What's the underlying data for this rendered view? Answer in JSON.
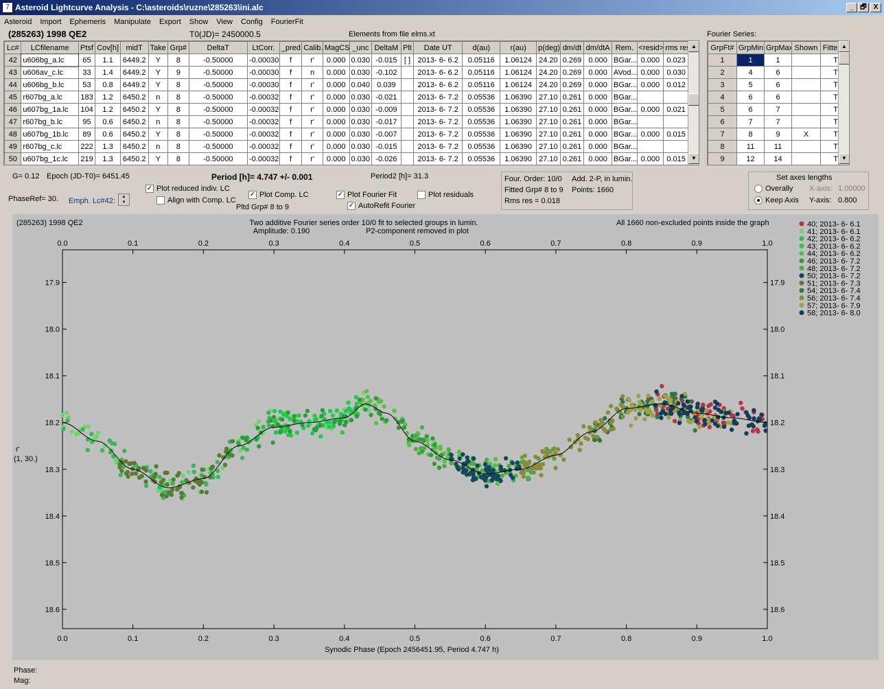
{
  "window": {
    "title": "Asteroid Lightcurve Analysis - C:\\asteroids\\ruzne\\285263\\ini.alc",
    "min": "_",
    "max": "🗗",
    "close": "X"
  },
  "menu": [
    "Asteroid",
    "Import",
    "Ephemeris",
    "Manipulate",
    "Export",
    "Show",
    "View",
    "Config",
    "FourierFit"
  ],
  "header": {
    "asteroid": "(285263) 1998 QE2",
    "t0": "T0(JD)= 2450000.5",
    "elements": "Elements from file elms.xt",
    "fourier_label": "Fourier Series:"
  },
  "lc_table": {
    "columns": [
      "Lc#",
      "LCfilename",
      "Ptsf",
      "Cov[h]",
      "midT",
      "Take",
      "Grp#",
      "DeltaT",
      "LtCorr.",
      "_pred.",
      "Calib.",
      "MagCS",
      "_unc",
      "DeltaM",
      "Plt",
      "Date UT",
      "d(au)",
      "r(au)",
      "p(deg)",
      "dm/dt",
      "dm/dtA",
      "Rem.",
      "<resid>",
      "rms res"
    ],
    "rows": [
      [
        "42",
        "u606bg_a.lc",
        "65",
        "1.1",
        "6449.2",
        "Y",
        "8",
        "-0.50000",
        "-0.00030",
        "f",
        "r'",
        "0.000",
        "0.030",
        "-0.015",
        "[ ]",
        "2013- 6- 6.2",
        "0.05116",
        "1.06124",
        "24.20",
        "0.269",
        "0.000",
        "BGar...",
        "0.000",
        "0.023"
      ],
      [
        "43",
        "u606av_c.lc",
        "33",
        "1.4",
        "6449.2",
        "Y",
        "9",
        "-0.50000",
        "-0.00030",
        "f",
        "n",
        "0.000",
        "0.030",
        "-0.102",
        "",
        "2013- 6- 6.2",
        "0.05116",
        "1.06124",
        "24.20",
        "0.269",
        "0.000",
        "AVod...",
        "0.000",
        "0.030"
      ],
      [
        "44",
        "u606bg_b.lc",
        "53",
        "0.8",
        "6449.2",
        "Y",
        "8",
        "-0.50000",
        "-0.00030",
        "f",
        "r'",
        "0.000",
        "0.040",
        "0.039",
        "",
        "2013- 6- 6.2",
        "0.05116",
        "1.06124",
        "24.20",
        "0.269",
        "0.000",
        "BGar...",
        "0.000",
        "0.012"
      ],
      [
        "45",
        "r607bg_a.lc",
        "183",
        "1.2",
        "6450.2",
        "n",
        "8",
        "-0.50000",
        "-0.00032",
        "f",
        "r'",
        "0.000",
        "0.030",
        "-0.021",
        "",
        "2013- 6- 7.2",
        "0.05536",
        "1.06390",
        "27.10",
        "0.261",
        "0.000",
        "BGar...",
        "",
        ""
      ],
      [
        "46",
        "u607bg_1a.lc",
        "104",
        "1.2",
        "6450.2",
        "Y",
        "8",
        "-0.50000",
        "-0.00032",
        "f",
        "r'",
        "0.000",
        "0.030",
        "-0.009",
        "",
        "2013- 6- 7.2",
        "0.05536",
        "1.06390",
        "27.10",
        "0.261",
        "0.000",
        "BGar...",
        "0.000",
        "0.021"
      ],
      [
        "47",
        "r607bg_b.lc",
        "95",
        "0.6",
        "6450.2",
        "n",
        "8",
        "-0.50000",
        "-0.00032",
        "f",
        "r'",
        "0.000",
        "0.030",
        "-0.017",
        "",
        "2013- 6- 7.2",
        "0.05536",
        "1.06390",
        "27.10",
        "0.261",
        "0.000",
        "BGar...",
        "",
        ""
      ],
      [
        "48",
        "u607bg_1b.lc",
        "89",
        "0.6",
        "6450.2",
        "Y",
        "8",
        "-0.50000",
        "-0.00032",
        "f",
        "r'",
        "0.000",
        "0.030",
        "-0.007",
        "",
        "2013- 6- 7.2",
        "0.05536",
        "1.06390",
        "27.10",
        "0.261",
        "0.000",
        "BGar...",
        "0.000",
        "0.015"
      ],
      [
        "49",
        "r607bg_c.lc",
        "222",
        "1.3",
        "6450.2",
        "n",
        "8",
        "-0.50000",
        "-0.00032",
        "f",
        "r'",
        "0.000",
        "0.030",
        "-0.015",
        "",
        "2013- 6- 7.2",
        "0.05536",
        "1.06390",
        "27.10",
        "0.261",
        "0.000",
        "BGar...",
        "",
        ""
      ],
      [
        "50",
        "u607bg_1c.lc",
        "219",
        "1.3",
        "6450.2",
        "Y",
        "8",
        "-0.50000",
        "-0.00032",
        "f",
        "r'",
        "0.000",
        "0.030",
        "-0.026",
        "",
        "2013- 6- 7.2",
        "0.05536",
        "1.06390",
        "27.10",
        "0.261",
        "0.000",
        "BGar...",
        "0.000",
        "0.015"
      ]
    ]
  },
  "fourier_table": {
    "columns": [
      "GrpFt#",
      "GrpMin",
      "GrpMax",
      "Shown",
      "Fitte"
    ],
    "rows": [
      [
        "1",
        "1",
        "1",
        "",
        "T"
      ],
      [
        "2",
        "4",
        "6",
        "",
        "T"
      ],
      [
        "3",
        "5",
        "6",
        "",
        "T"
      ],
      [
        "4",
        "6",
        "6",
        "",
        "T"
      ],
      [
        "5",
        "6",
        "7",
        "",
        "T"
      ],
      [
        "6",
        "7",
        "7",
        "",
        "T"
      ],
      [
        "7",
        "8",
        "9",
        "X",
        "T"
      ],
      [
        "8",
        "11",
        "11",
        "",
        "T"
      ],
      [
        "9",
        "12",
        "14",
        "",
        "T"
      ]
    ]
  },
  "params": {
    "g": "G= 0.12",
    "epoch": "Epoch (JD-T0)= 6451.45",
    "period": "Period [h]= 4.747 +/- 0.001",
    "period2": "Period2 [h]= 31.3",
    "phaseref": "PhaseRef= 30.",
    "emph": "Emph. Lc#42:"
  },
  "options": {
    "plot_reduced": "Plot reduced indiv. LC",
    "align": "Align with Comp. LC",
    "plot_comp": "Plot Comp. LC",
    "pltd_grp": "Pltd Grp#  8  to  9",
    "plot_fourier": "Plot Fourier Fit",
    "autorefit": "AutoRefit Fourier",
    "plot_resid": "Plot residuals"
  },
  "fit_info": {
    "order": "Four. Order: 10/0",
    "add": "Add. 2-P, in lumin.",
    "fitted": "Fitted Grp# 8 to 9",
    "points": "Points: 1660",
    "rms": "Rms res     = 0.018"
  },
  "axes_box": {
    "title": "Set axes lengths",
    "overall": "Overally",
    "keep": "Keep Axis",
    "xaxis": "X-axis:",
    "xval": "1.00000",
    "yaxis": "Y-axis:",
    "yval": "0.800"
  },
  "footer": {
    "phase": "Phase:",
    "mag": "Mag:"
  },
  "chart_data": {
    "type": "scatter",
    "title": "Two additive Fourier series order 10/0 fit to selected groups in lumin.",
    "subtitle": "Amplitude: 0.190",
    "note": "P2-component removed in plot",
    "corner_label": "(285263) 1998 QE2",
    "points_note": "All 1660 non-excluded points inside the graph",
    "xlabel": "Synodic Phase (Epoch 2456451.95, Period 4.747 h)",
    "ylabel": "r'",
    "ylabel2": "(1, 30.)",
    "xlim": [
      0,
      1
    ],
    "ylim": [
      18.8,
      17.8
    ],
    "y_inverted": true,
    "x_ticks": [
      "0.0",
      "0.1",
      "0.2",
      "0.3",
      "0.4",
      "0.5",
      "0.6",
      "0.7",
      "0.8",
      "0.9",
      "1.0"
    ],
    "y_ticks": [
      "17.9",
      "18.0",
      "18.1",
      "18.2",
      "18.3",
      "18.4",
      "18.5",
      "18.6"
    ],
    "legend_position": "right",
    "series": [
      {
        "name": "40; 2013- 6- 6.1",
        "color": "#b8324a",
        "x_range": [
          0.82,
          1.0
        ]
      },
      {
        "name": "41; 2013- 6- 6.1",
        "color": "#6ed46e",
        "x_range": [
          0.0,
          0.45
        ]
      },
      {
        "name": "42; 2013- 6- 6.2",
        "color": "#3cb45a",
        "x_range": [
          0.0,
          0.3
        ]
      },
      {
        "name": "43; 2013- 6- 6.2",
        "color": "#22c94c",
        "x_range": [
          0.3,
          0.42
        ]
      },
      {
        "name": "44; 2013- 6- 6.2",
        "color": "#58c048",
        "x_range": [
          0.42,
          0.62
        ]
      },
      {
        "name": "46; 2013- 6- 7.2",
        "color": "#2f9a3c",
        "x_range": [
          0.25,
          0.55
        ]
      },
      {
        "name": "48; 2013- 6- 7.2",
        "color": "#4faa4a",
        "x_range": [
          0.5,
          0.7
        ]
      },
      {
        "name": "50; 2013- 6- 7.2",
        "color": "#12485c",
        "x_range": [
          0.55,
          0.65
        ]
      },
      {
        "name": "51; 2013- 6- 7.3",
        "color": "#5a7a32",
        "x_range": [
          0.08,
          0.25
        ]
      },
      {
        "name": "54; 2013- 6- 7.4",
        "color": "#2a7a40",
        "x_range": [
          0.75,
          0.9
        ]
      },
      {
        "name": "56; 2013- 6- 7.4",
        "color": "#8a8a3a",
        "x_range": [
          0.65,
          0.8
        ]
      },
      {
        "name": "57; 2013- 6- 7.9",
        "color": "#a0a048",
        "x_range": [
          0.8,
          0.95
        ]
      },
      {
        "name": "58; 2013- 6- 8.0",
        "color": "#143c5a",
        "x_range": [
          0.84,
          1.0
        ]
      }
    ],
    "fit_curve": {
      "x": [
        0,
        0.05,
        0.1,
        0.15,
        0.2,
        0.25,
        0.3,
        0.35,
        0.4,
        0.43,
        0.46,
        0.5,
        0.55,
        0.6,
        0.65,
        0.7,
        0.75,
        0.8,
        0.85,
        0.9,
        0.95,
        1.0
      ],
      "y": [
        18.2,
        18.24,
        18.3,
        18.34,
        18.32,
        18.25,
        18.21,
        18.2,
        18.19,
        18.16,
        18.18,
        18.24,
        18.28,
        18.31,
        18.3,
        18.27,
        18.22,
        18.17,
        18.16,
        18.18,
        18.19,
        18.2
      ]
    }
  }
}
